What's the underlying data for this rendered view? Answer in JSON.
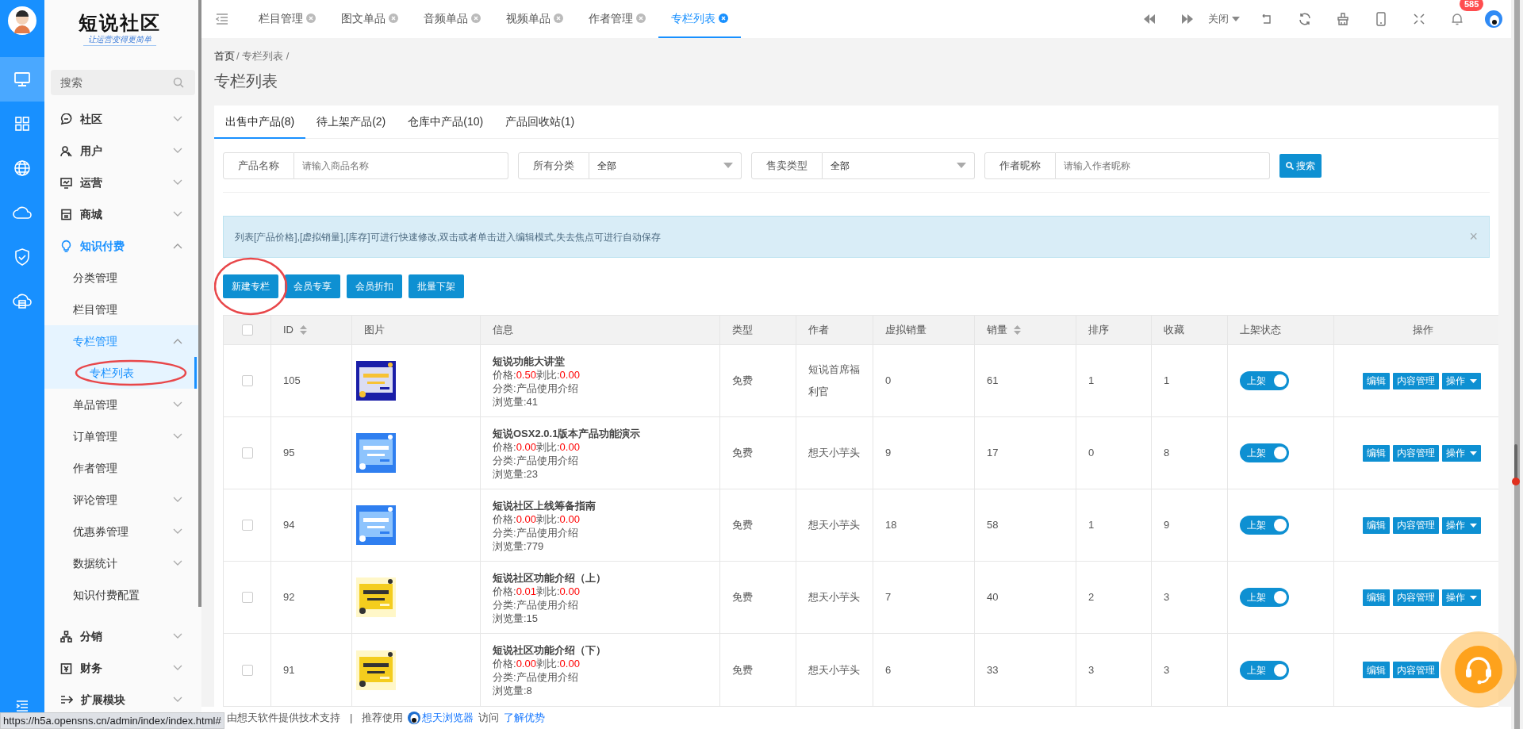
{
  "rail": [
    {
      "selected": true
    },
    {
      "selected": false
    },
    {
      "selected": false
    },
    {
      "selected": false
    },
    {
      "selected": false
    },
    {
      "selected": false
    }
  ],
  "logo": {
    "title": "短说社区",
    "slogan": "让运营变得更简单"
  },
  "sidebar": {
    "search_placeholder": "搜索",
    "items": [
      {
        "label": "社区",
        "expanded": false,
        "selected": false
      },
      {
        "label": "用户",
        "expanded": false,
        "selected": false
      },
      {
        "label": "运营",
        "expanded": false,
        "selected": false
      },
      {
        "label": "商城",
        "expanded": false,
        "selected": false
      },
      {
        "label": "知识付费",
        "expanded": true,
        "selected": false,
        "children": [
          {
            "label": "分类管理",
            "selected": false
          },
          {
            "label": "栏目管理",
            "selected": false
          },
          {
            "label": "专栏管理",
            "expanded": true,
            "selected": false,
            "children": [
              {
                "label": "专栏列表",
                "selected": true
              }
            ]
          },
          {
            "label": "单品管理",
            "expanded": false,
            "selected": false
          },
          {
            "label": "订单管理",
            "expanded": false,
            "selected": false
          },
          {
            "label": "作者管理",
            "selected": false
          },
          {
            "label": "评论管理",
            "expanded": false,
            "selected": false
          },
          {
            "label": "优惠券管理",
            "expanded": false,
            "selected": false
          },
          {
            "label": "数据统计",
            "expanded": false,
            "selected": false
          },
          {
            "label": "知识付费配置",
            "selected": false
          }
        ]
      },
      {
        "label": "分销",
        "expanded": false,
        "selected": false
      },
      {
        "label": "财务",
        "expanded": false,
        "selected": false
      },
      {
        "label": "扩展模块",
        "expanded": false,
        "selected": false
      }
    ]
  },
  "top_tabs": [
    {
      "label": "栏目管理",
      "selected": false
    },
    {
      "label": "图文单品",
      "selected": false
    },
    {
      "label": "音频单品",
      "selected": false
    },
    {
      "label": "视频单品",
      "selected": false
    },
    {
      "label": "作者管理",
      "selected": false
    },
    {
      "label": "专栏列表",
      "selected": true
    }
  ],
  "toolbar": {
    "close_menu": "关闭",
    "notification_count": "585"
  },
  "breadcrumb": [
    {
      "label": "首页",
      "kind": "link"
    },
    {
      "label": "/ 专栏列表 /",
      "kind": "text"
    }
  ],
  "page_title": "专栏列表",
  "product_tabs": [
    {
      "label": "出售中产品(8)",
      "selected": true
    },
    {
      "label": "待上架产品(2)",
      "selected": false
    },
    {
      "label": "仓库中产品(10)",
      "selected": false
    },
    {
      "label": "产品回收站(1)",
      "selected": false
    }
  ],
  "filters": [
    {
      "label": "产品名称",
      "kind": "input",
      "placeholder": "请输入商品名称"
    },
    {
      "label": "所有分类",
      "kind": "select",
      "value": "全部"
    },
    {
      "label": "售卖类型",
      "kind": "select",
      "value": "全部"
    },
    {
      "label": "作者昵称",
      "kind": "input",
      "placeholder": "请输入作者昵称"
    }
  ],
  "search_button": "搜索",
  "alert": {
    "text": "列表[产品价格],[虚拟销量],[库存]可进行快速修改,双击或者单击进入编辑模式,失去焦点可进行自动保存",
    "close": "×"
  },
  "actions": [
    "新建专栏",
    "会员专享",
    "会员折扣",
    "批量下架"
  ],
  "table": {
    "select_all": {
      "checked": false
    },
    "columns": [
      {
        "label": "ID",
        "sortable": true
      },
      {
        "label": "图片",
        "sortable": false
      },
      {
        "label": "信息",
        "sortable": false
      },
      {
        "label": "类型",
        "sortable": false
      },
      {
        "label": "作者",
        "sortable": false
      },
      {
        "label": "虚拟销量",
        "sortable": false
      },
      {
        "label": "销量",
        "sortable": true
      },
      {
        "label": "排序",
        "sortable": false
      },
      {
        "label": "收藏",
        "sortable": false
      },
      {
        "label": "上架状态",
        "sortable": false
      },
      {
        "label": "操作",
        "sortable": false
      }
    ],
    "rows": [
      {
        "checked": false,
        "id": "105",
        "image": {
          "kind": "picture"
        },
        "title": "短说功能大讲堂",
        "price_label": "价格:",
        "price": "0.50",
        "ratio_label": "剥比:",
        "ratio": "0.00",
        "category": "分类:产品使用介绍",
        "views": "浏览量:41",
        "type": "免费",
        "author": "短说首席福利官",
        "virtual_sales": "0",
        "sales": "61",
        "sort": "1",
        "favorites": "1",
        "status": {
          "label": "上架",
          "on": true
        },
        "buttons": [
          "编辑",
          "内容管理",
          "操作"
        ]
      },
      {
        "checked": false,
        "id": "95",
        "image": {
          "kind": "picture"
        },
        "title": "短说OSX2.0.1版本产品功能演示",
        "price_label": "价格:",
        "price": "0.00",
        "ratio_label": "剥比:",
        "ratio": "0.00",
        "category": "分类:产品使用介绍",
        "views": "浏览量:23",
        "type": "免费",
        "author": "想天小芋头",
        "virtual_sales": "9",
        "sales": "17",
        "sort": "0",
        "favorites": "8",
        "status": {
          "label": "上架",
          "on": true
        },
        "buttons": [
          "编辑",
          "内容管理",
          "操作"
        ]
      },
      {
        "checked": false,
        "id": "94",
        "image": {
          "kind": "picture"
        },
        "title": "短说社区上线筹备指南",
        "price_label": "价格:",
        "price": "0.00",
        "ratio_label": "剥比:",
        "ratio": "0.00",
        "category": "分类:产品使用介绍",
        "views": "浏览量:779",
        "type": "免费",
        "author": "想天小芋头",
        "virtual_sales": "18",
        "sales": "58",
        "sort": "1",
        "favorites": "9",
        "status": {
          "label": "上架",
          "on": true
        },
        "buttons": [
          "编辑",
          "内容管理",
          "操作"
        ]
      },
      {
        "checked": false,
        "id": "92",
        "image": {
          "kind": "picture"
        },
        "title": "短说社区功能介绍（上）",
        "price_label": "价格:",
        "price": "0.01",
        "ratio_label": "剥比:",
        "ratio": "0.00",
        "category": "分类:产品使用介绍",
        "views": "浏览量:15",
        "type": "免费",
        "author": "想天小芋头",
        "virtual_sales": "7",
        "sales": "40",
        "sort": "2",
        "favorites": "3",
        "status": {
          "label": "上架",
          "on": true
        },
        "buttons": [
          "编辑",
          "内容管理",
          "操作"
        ]
      },
      {
        "checked": false,
        "id": "91",
        "image": {
          "kind": "picture"
        },
        "title": "短说社区功能介绍（下）",
        "price_label": "价格:",
        "price": "0.00",
        "ratio_label": "剥比:",
        "ratio": "0.00",
        "category": "分类:产品使用介绍",
        "views": "浏览量:8",
        "type": "免费",
        "author": "想天小芋头",
        "virtual_sales": "6",
        "sales": "33",
        "sort": "3",
        "favorites": "3",
        "status": {
          "label": "上架",
          "on": true
        },
        "buttons": [
          "编辑",
          "内容管理"
        ]
      }
    ]
  },
  "footer": {
    "support": "由想天软件提供技术支持",
    "separator": "|",
    "recommend": "推荐使用",
    "browser_link": "想天浏览器",
    "visit": "访问",
    "learn_link": "了解优势"
  },
  "status_url": "https://h5a.opensns.cn/admin/index/index.html#"
}
